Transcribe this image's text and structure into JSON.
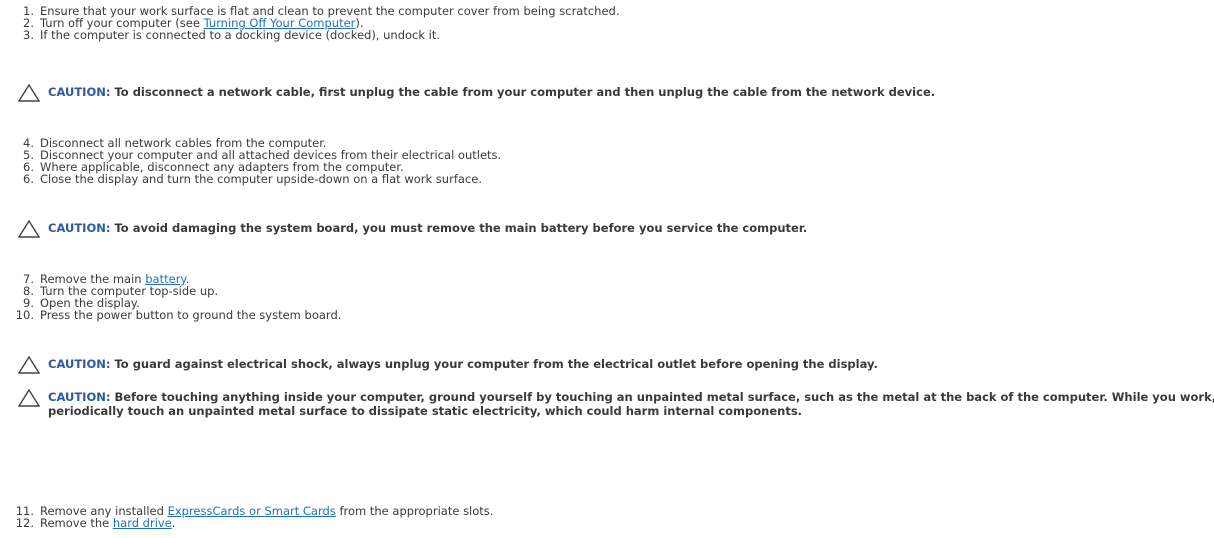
{
  "list1": [
    {
      "num": "1.",
      "parts": [
        {
          "t": "Ensure that your work surface is flat and clean to prevent the computer cover from being scratched."
        }
      ]
    },
    {
      "num": "2.",
      "parts": [
        {
          "t": "Turn off your computer (see "
        },
        {
          "t": "Turning Off Your Computer",
          "link": true
        },
        {
          "t": ")."
        }
      ]
    },
    {
      "num": "3.",
      "parts": [
        {
          "t": "If the computer is connected to a docking device (docked), undock it."
        }
      ]
    }
  ],
  "caution_label": "CAUTION:",
  "caution1": "To disconnect a network cable, first unplug the cable from your computer and then unplug the cable from the network device.",
  "list2": [
    {
      "num": "4.",
      "parts": [
        {
          "t": "Disconnect all network cables from the computer."
        }
      ]
    },
    {
      "num": "5.",
      "parts": [
        {
          "t": "Disconnect your computer and all attached devices from their electrical outlets."
        }
      ]
    },
    {
      "num": "6.",
      "parts": [
        {
          "t": "Where applicable, disconnect any adapters from the computer."
        }
      ]
    },
    {
      "num": "6.",
      "parts": [
        {
          "t": "Close the display and turn the computer upside-down on a flat work surface."
        }
      ]
    }
  ],
  "caution2": "To avoid damaging the system board, you must remove the main battery before you service the computer.",
  "list3": [
    {
      "num": "7.",
      "parts": [
        {
          "t": "Remove the main "
        },
        {
          "t": "battery",
          "link": true
        },
        {
          "t": "."
        }
      ]
    },
    {
      "num": "8.",
      "parts": [
        {
          "t": "Turn the computer top-side up."
        }
      ]
    },
    {
      "num": "9.",
      "parts": [
        {
          "t": "Open the display."
        }
      ]
    },
    {
      "num": "10.",
      "parts": [
        {
          "t": "Press the power button to ground the system board."
        }
      ]
    }
  ],
  "caution3": "To guard against electrical shock, always unplug your computer from the electrical outlet before opening the display.",
  "caution4": "Before touching anything inside your computer, ground yourself by touching an unpainted metal surface, such as the metal at the back of the computer. While you work, periodically touch an unpainted metal surface to dissipate static electricity, which could harm internal components.",
  "list4": [
    {
      "num": "11.",
      "parts": [
        {
          "t": "Remove any installed "
        },
        {
          "t": "ExpressCards or Smart Cards",
          "link": true
        },
        {
          "t": " from the appropriate slots."
        }
      ]
    },
    {
      "num": "12.",
      "parts": [
        {
          "t": "Remove the "
        },
        {
          "t": "hard drive",
          "link": true
        },
        {
          "t": "."
        }
      ]
    }
  ]
}
